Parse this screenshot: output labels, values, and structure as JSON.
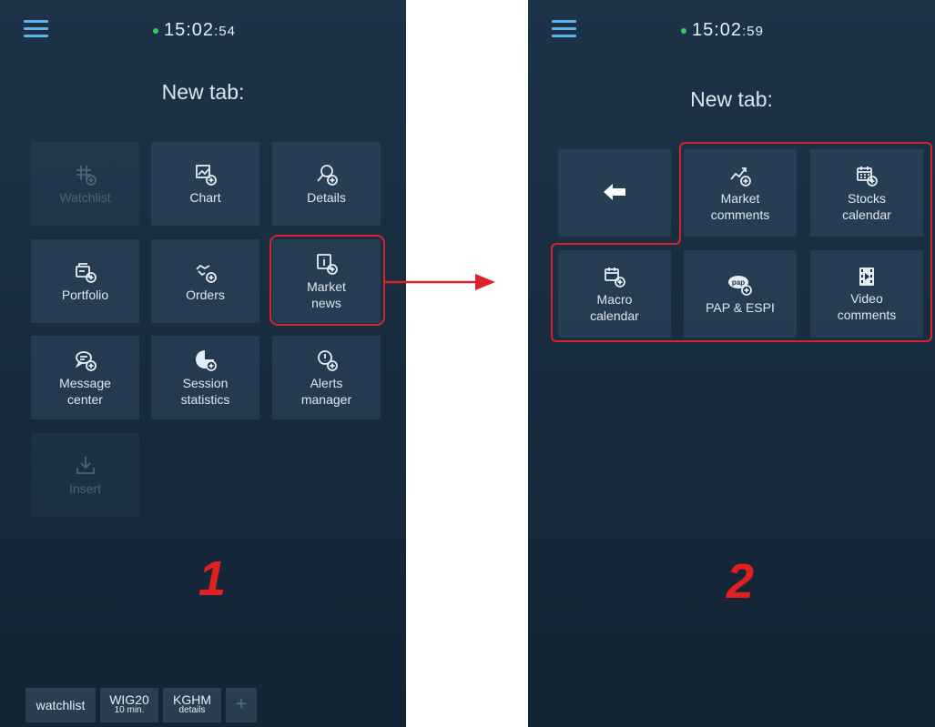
{
  "screen1": {
    "time_main": "15:02",
    "time_sec": ":54",
    "title": "New tab:",
    "tiles": [
      {
        "label": "Watchlist",
        "icon": "watchlist-icon",
        "enabled": false
      },
      {
        "label": "Chart",
        "icon": "chart-icon",
        "enabled": true
      },
      {
        "label": "Details",
        "icon": "details-icon",
        "enabled": true
      },
      {
        "label": "Portfolio",
        "icon": "portfolio-icon",
        "enabled": true
      },
      {
        "label": "Orders",
        "icon": "orders-icon",
        "enabled": true
      },
      {
        "label": "Market\nnews",
        "icon": "market-news-icon",
        "enabled": true
      },
      {
        "label": "Message\ncenter",
        "icon": "message-icon",
        "enabled": true
      },
      {
        "label": "Session\nstatistics",
        "icon": "statistics-icon",
        "enabled": true
      },
      {
        "label": "Alerts\nmanager",
        "icon": "alerts-icon",
        "enabled": true
      },
      {
        "label": "Insert",
        "icon": "insert-icon",
        "enabled": false
      }
    ],
    "annotation": "1",
    "bottom_tabs": [
      {
        "label": "watchlist",
        "sub": ""
      },
      {
        "label": "WIG20",
        "sub": "10 min."
      },
      {
        "label": "KGHM",
        "sub": "details"
      }
    ],
    "add_tab": "+"
  },
  "screen2": {
    "time_main": "15:02",
    "time_sec": ":59",
    "title": "New tab:",
    "back_icon": "back-arrow-icon",
    "tiles": [
      {
        "label": "Market\ncomments",
        "icon": "market-comments-icon"
      },
      {
        "label": "Stocks\ncalendar",
        "icon": "stocks-calendar-icon"
      },
      {
        "label": "Macro\ncalendar",
        "icon": "macro-calendar-icon"
      },
      {
        "label": "PAP & ESPI",
        "icon": "pap-espi-icon"
      },
      {
        "label": "Video\ncomments",
        "icon": "video-comments-icon"
      }
    ],
    "annotation": "2"
  },
  "colors": {
    "highlight": "#d9232b",
    "accent": "#5fb3e6",
    "live_dot": "#2ecc5a"
  }
}
